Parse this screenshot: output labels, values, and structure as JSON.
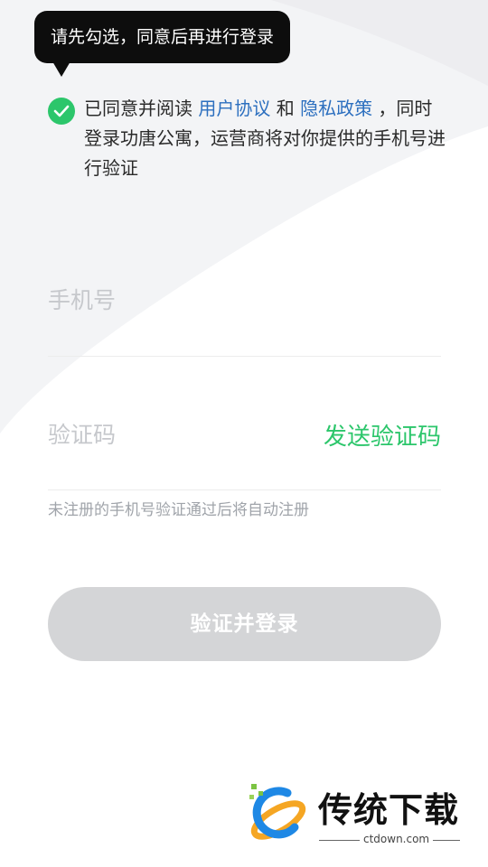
{
  "tooltip": {
    "text": "请先勾选，同意后再进行登录"
  },
  "agreement": {
    "prefix": "已同意并阅读 ",
    "user_agreement": "用户协议",
    "conjunction": " 和 ",
    "privacy_policy": "隐私政策",
    "suffix": " ，同时登录功唐公寓，运营商将对你提供的手机号进行验证",
    "checked": true
  },
  "phone": {
    "placeholder": "手机号",
    "value": ""
  },
  "code": {
    "placeholder": "验证码",
    "value": "",
    "send_label": "发送验证码"
  },
  "hint": "未注册的手机号验证通过后将自动注册",
  "login_button": "验证并登录",
  "watermark": {
    "title": "传统下载",
    "url": "ctdown.com"
  },
  "colors": {
    "accent": "#2cc66b",
    "link": "#2c6fbf",
    "disabled_button": "#d4d5d7",
    "tooltip_bg": "#0d0d0d"
  }
}
